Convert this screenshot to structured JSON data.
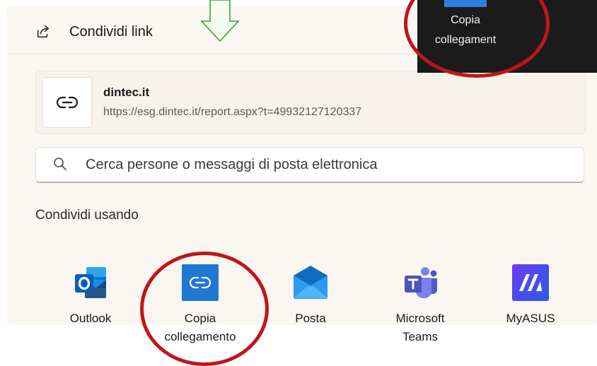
{
  "header": {
    "title": "Condividi link"
  },
  "link": {
    "title": "dintec.it",
    "url": "https://esg.dintec.it/report.aspx?t=49932127120337"
  },
  "search": {
    "placeholder": "Cerca persone o messaggi di posta elettronica",
    "value": ""
  },
  "section": {
    "title": "Condividi usando"
  },
  "apps": [
    {
      "label_line1": "Outlook",
      "label_line2": "",
      "icon": "outlook-icon"
    },
    {
      "label_line1": "Copia",
      "label_line2": "collegamento",
      "icon": "copy-link-icon"
    },
    {
      "label_line1": "Posta",
      "label_line2": "",
      "icon": "mail-icon"
    },
    {
      "label_line1": "Microsoft",
      "label_line2": "Teams",
      "icon": "teams-icon"
    },
    {
      "label_line1": "MyASUS",
      "label_line2": "",
      "icon": "myasus-icon"
    }
  ],
  "inset": {
    "label_line1": "Copia",
    "label_line2": "collegament"
  },
  "colors": {
    "panel_bg": "#faf6f1",
    "annotation_red": "#c0151b",
    "arrow_green": "#3a9a3a",
    "copy_blue": "#1f78d1"
  }
}
